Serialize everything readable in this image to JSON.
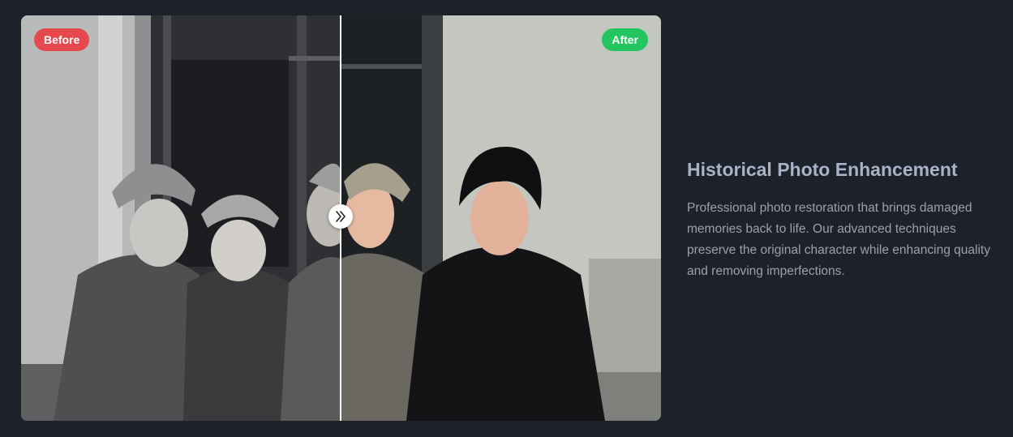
{
  "comparison": {
    "before_label": "Before",
    "after_label": "After",
    "handle_icon": "chevrons-right-icon",
    "split_fraction": 0.5,
    "colors": {
      "before_badge": "#e5484d",
      "after_badge": "#22c55e"
    }
  },
  "feature": {
    "title": "Historical Photo Enhancement",
    "description": "Professional photo restoration that brings damaged memories back to life. Our advanced techniques preserve the original character while enhancing quality and removing imperfections."
  },
  "colors": {
    "page_background": "#1d2129",
    "title": "#a9b3c7",
    "body_text": "#9aa1ad"
  }
}
